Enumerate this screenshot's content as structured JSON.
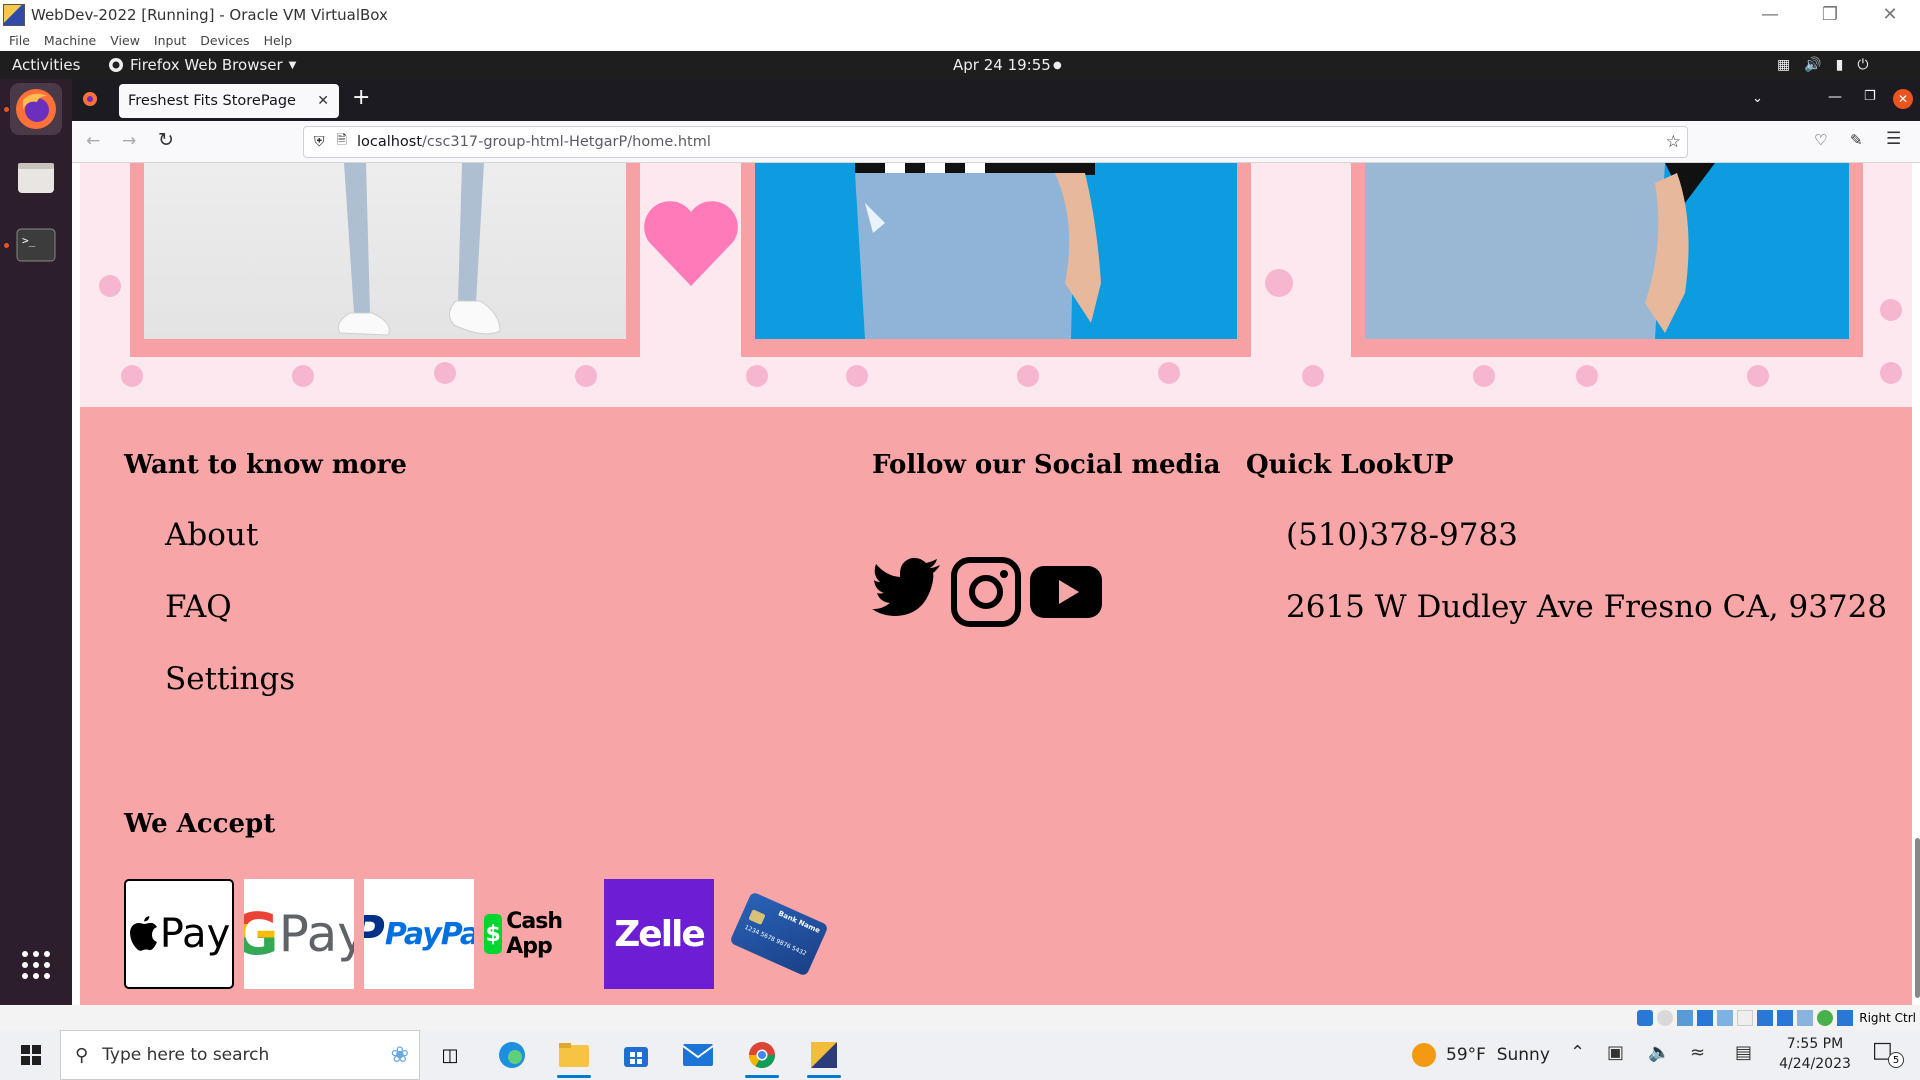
{
  "vbox": {
    "title": "WebDev-2022 [Running] - Oracle VM VirtualBox",
    "menu": [
      "File",
      "Machine",
      "View",
      "Input",
      "Devices",
      "Help"
    ],
    "status_label": "Right Ctrl"
  },
  "gnome": {
    "activities": "Activities",
    "app_menu": "Firefox Web Browser",
    "clock": "Apr 24  19:55"
  },
  "browser": {
    "tab_title": "Freshest Fits StorePage",
    "url_host": "localhost",
    "url_path": "/csc317-group-html-HetgarP/home.html"
  },
  "footer": {
    "know_more_heading": "Want to know more",
    "links": [
      "About",
      "FAQ",
      "Settings"
    ],
    "social_heading": "Follow our Social media",
    "lookup_heading": "Quick LookUP",
    "phone": "(510)378-9783",
    "address": "2615 W Dudley Ave Fresno CA, 93728",
    "accept_heading": "We Accept",
    "payments": {
      "apple_pay": "Pay",
      "google_pay": "Pay",
      "paypal": "PayPal",
      "cash_app": "Cash App",
      "zelle": "Zelle",
      "card_bank": "Bank Name",
      "card_number": "1234 5678 9876 5432"
    }
  },
  "taskbar": {
    "search_placeholder": "Type here to search",
    "weather": "59°F  Sunny",
    "time": "7:55 PM",
    "date": "4/24/2023",
    "notification_count": "5"
  },
  "colors": {
    "footer_bg": "#f7a5a6",
    "gallery_bg": "#fde8ef",
    "frame": "#f7a1a5",
    "heart": "#ff7ab8",
    "zelle": "#6d1ed4"
  }
}
